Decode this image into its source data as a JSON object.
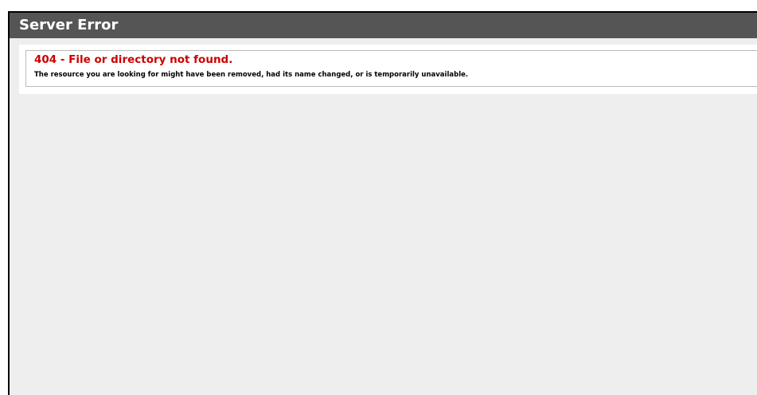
{
  "header": {
    "title": "Server Error"
  },
  "error": {
    "title": "404 - File or directory not found.",
    "description": "The resource you are looking for might have been removed, had its name changed, or is temporarily unavailable."
  },
  "colors": {
    "header_bg": "#555555",
    "page_bg": "#eeeeee",
    "error_title": "#cc0000"
  }
}
